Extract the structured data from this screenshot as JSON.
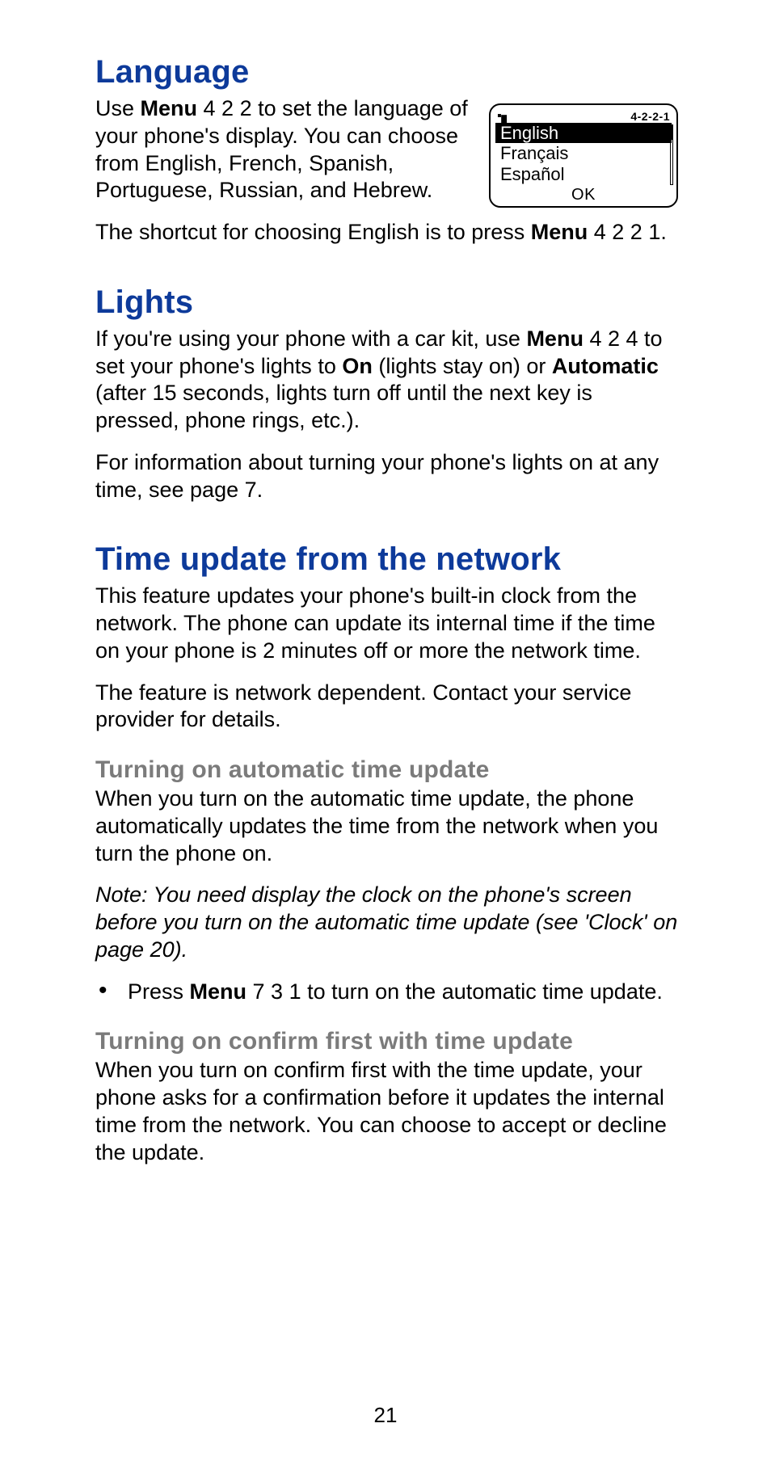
{
  "pageNumber": "21",
  "language": {
    "heading": "Language",
    "p1_pre": "Use ",
    "p1_bold": "Menu",
    "p1_post": " 4 2 2 to set the language of your phone's display. You can choose from English, French, Spanish, Portuguese, Russian, and Hebrew.",
    "p2_pre": "The shortcut for choosing English is to press ",
    "p2_bold": "Menu",
    "p2_post": " 4 2 2 1."
  },
  "phone": {
    "menuCode": "4-2-2-1",
    "options": [
      "English",
      "Français",
      "Español"
    ],
    "selectedIndex": 0,
    "softkey": "OK"
  },
  "lights": {
    "heading": "Lights",
    "p1_a": "If you're using your phone with a car kit, use ",
    "p1_b_bold": "Menu",
    "p1_c": " 4 2 4 to set your phone's lights to ",
    "p1_d_bold": "On",
    "p1_e": " (lights stay on) or ",
    "p1_f_bold": "Automatic",
    "p1_g": " (after 15 seconds, lights turn off until the next key is pressed, phone rings, etc.).",
    "p2": "For information about turning your phone's lights on at any time, see page 7."
  },
  "timeUpdate": {
    "heading": "Time update from the network",
    "p1": "This feature updates your phone's built-in clock from the network. The phone can update its internal time if the time on your phone is 2 minutes off or more the network time.",
    "p2": "The feature is network dependent. Contact your service provider for details.",
    "auto": {
      "heading": "Turning on automatic time update",
      "p1": "When you turn on the automatic time update, the phone automatically updates the time from the network when you turn the phone on.",
      "note": "Note: You need display the clock on the phone's screen before you turn on the automatic time update  (see 'Clock' on page 20).",
      "bullet_pre": "Press ",
      "bullet_bold": "Menu",
      "bullet_post": " 7 3 1 to turn on the automatic time update."
    },
    "confirm": {
      "heading": "Turning on confirm first with time update",
      "p1": "When you turn on confirm first with the time update, your phone asks for a confirmation before it updates the internal time from the network. You can choose to accept or decline the update."
    }
  }
}
